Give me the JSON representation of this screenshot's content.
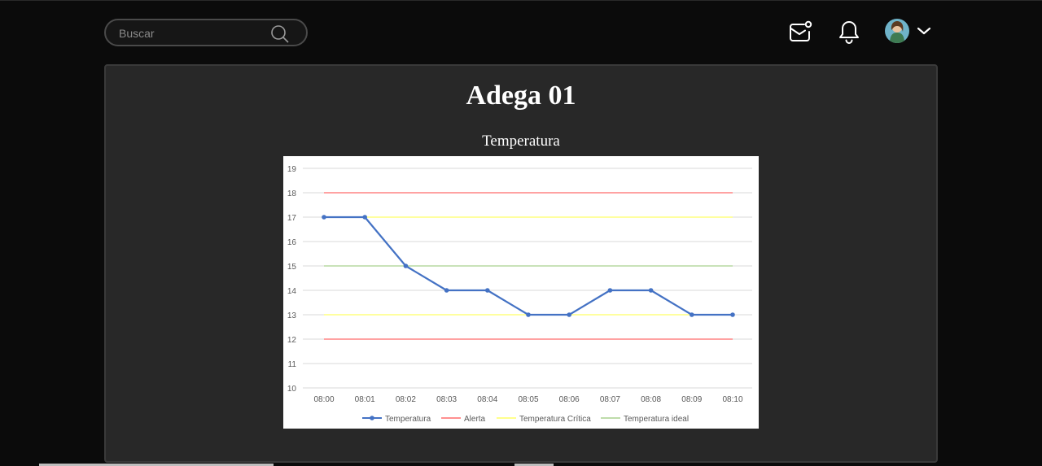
{
  "search": {
    "placeholder": "Buscar",
    "value": "",
    "icon": "search-icon"
  },
  "header": {
    "icons": {
      "mail": "mail-notification-icon",
      "bell": "bell-icon",
      "avatar": "avatar",
      "chevron": "chevron-down-icon"
    }
  },
  "main": {
    "title": "Adega 01",
    "chart_title": "Temperatura"
  },
  "colors": {
    "background": "#0b0b0b",
    "panel": "#282828",
    "temperatura": "#4472c4",
    "alerta": "#ff6b6b",
    "critica": "#ffff66",
    "ideal": "#a9d18e"
  },
  "chart_data": {
    "type": "line",
    "title": "Temperatura",
    "xlabel": "",
    "ylabel": "",
    "categories": [
      "08:00",
      "08:01",
      "08:02",
      "08:03",
      "08:04",
      "08:05",
      "08:06",
      "08:07",
      "08:08",
      "08:09",
      "08:10"
    ],
    "ylim": [
      10,
      19
    ],
    "yticks": [
      10,
      11,
      12,
      13,
      14,
      15,
      16,
      17,
      18,
      19
    ],
    "grid": true,
    "legend_position": "bottom",
    "series": [
      {
        "name": "Temperatura",
        "color": "#4472c4",
        "markers": true,
        "values": [
          17,
          17,
          15,
          14,
          14,
          13,
          13,
          14,
          14,
          13,
          13
        ]
      },
      {
        "name": "Alerta",
        "color": "#ff6b6b",
        "markers": false,
        "values": [
          18,
          18,
          18,
          18,
          18,
          18,
          18,
          18,
          18,
          18,
          18
        ]
      },
      {
        "name": "Alerta",
        "color": "#ff6b6b",
        "markers": false,
        "legend": false,
        "values": [
          12,
          12,
          12,
          12,
          12,
          12,
          12,
          12,
          12,
          12,
          12
        ]
      },
      {
        "name": "Temperatura Crítica",
        "color": "#ffff66",
        "markers": false,
        "values": [
          17,
          17,
          17,
          17,
          17,
          17,
          17,
          17,
          17,
          17,
          17
        ]
      },
      {
        "name": "Temperatura Crítica",
        "color": "#ffff66",
        "markers": false,
        "legend": false,
        "values": [
          13,
          13,
          13,
          13,
          13,
          13,
          13,
          13,
          13,
          13,
          13
        ]
      },
      {
        "name": "Temperatura ideal",
        "color": "#a9d18e",
        "markers": false,
        "values": [
          15,
          15,
          15,
          15,
          15,
          15,
          15,
          15,
          15,
          15,
          15
        ]
      }
    ]
  }
}
